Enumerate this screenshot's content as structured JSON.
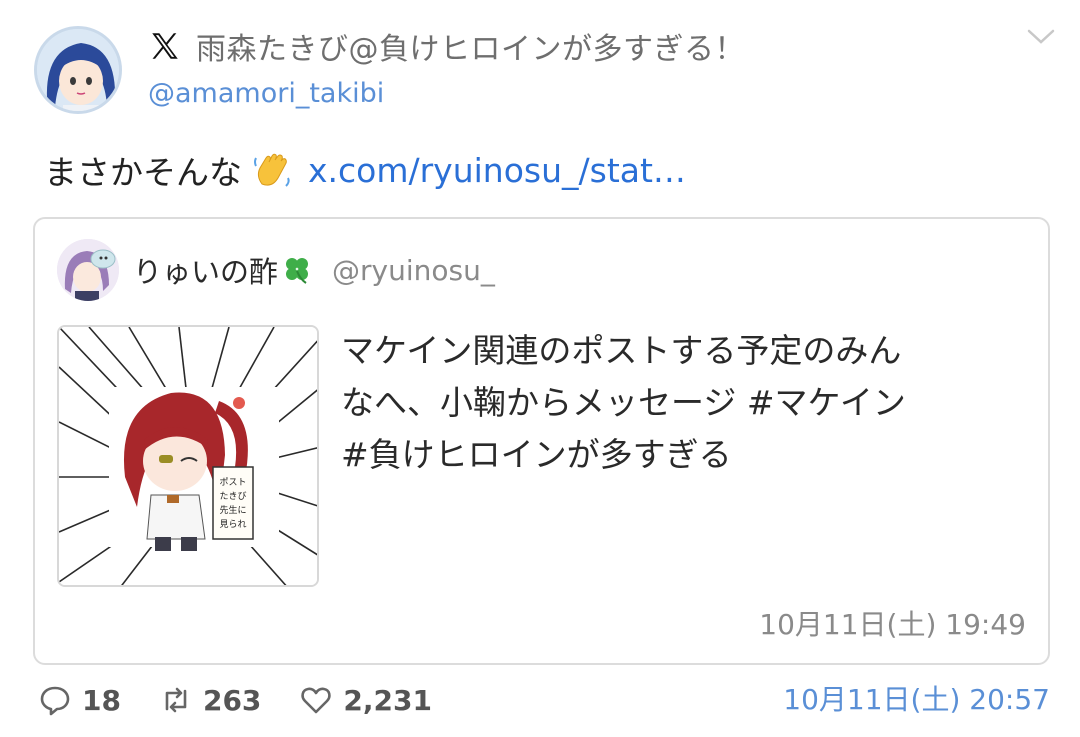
{
  "author": {
    "display_name": "雨森たきび@負けヒロインが多すぎる！",
    "handle": "@amamori_takibi"
  },
  "tweet": {
    "text": "まさかそんな",
    "emoji": "wave-emoji",
    "link": "x.com/ryuinosu_/stat…"
  },
  "quote": {
    "display_name": "りゅいの酢",
    "handle": "@ryuinosu_",
    "text_lines": [
      "マケイン関連のポストする予定のみん",
      "なへ、小鞠からメッセージ #マケイン",
      "#負けヒロインが多すぎる"
    ],
    "image_sign_text": "ポストはたきび先生に見られている",
    "timestamp": "10月11日(土) 19:49"
  },
  "actions": {
    "replies": "18",
    "reposts": "263",
    "likes": "2,231"
  },
  "post_timestamp": "10月11日(土) 20:57",
  "colors": {
    "link": "#2a6fd6",
    "handle": "#5a8fd6",
    "muted": "#8a8a8a"
  }
}
